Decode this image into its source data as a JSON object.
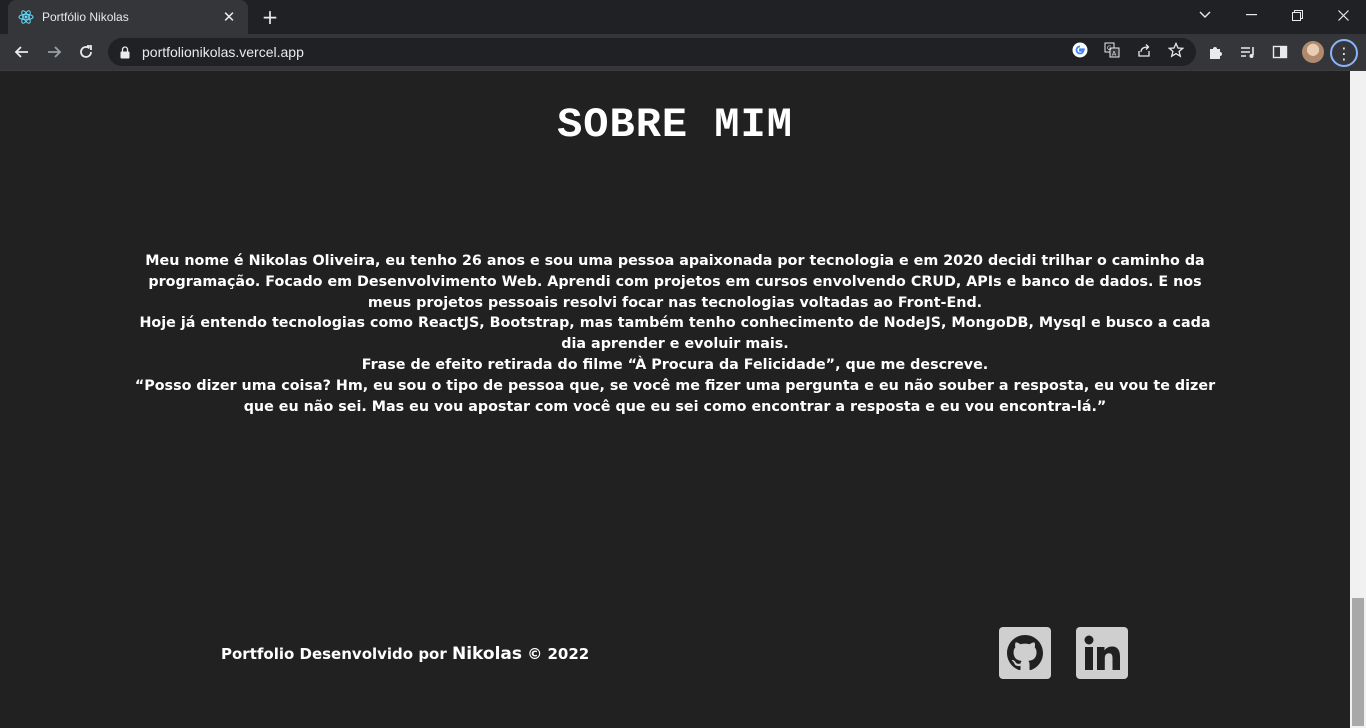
{
  "browser": {
    "tab_title": "Portfólio Nikolas",
    "url": "portfolionikolas.vercel.app",
    "icons": {
      "favicon": "react-icon",
      "close": "close-icon",
      "new_tab": "plus-icon"
    },
    "new_tab_glyph": "+",
    "tab_close_glyph": "✕"
  },
  "about": {
    "title": "SOBRE MIM",
    "paragraphs": [
      "Meu nome é Nikolas Oliveira, eu tenho 26 anos e sou uma pessoa apaixonada por tecnologia e em 2020 decidi trilhar o caminho da programação. Focado em Desenvolvimento Web. Aprendi com projetos em cursos envolvendo CRUD, APIs e banco de dados. E nos meus projetos pessoais resolvi focar nas tecnologias voltadas ao Front-End.",
      "Hoje já entendo tecnologias como ReactJS, Bootstrap, mas também tenho conhecimento de NodeJS, MongoDB, Mysql e busco a cada dia aprender e evoluir mais.",
      "Frase de efeito retirada do filme “À Procura da Felicidade”, que me descreve.",
      "“Posso dizer uma coisa? Hm, eu sou o tipo de pessoa que, se você me fizer uma pergunta e eu não souber a resposta, eu vou te dizer que eu não sei. Mas eu vou apostar com você que eu sei como encontrar a resposta e eu vou encontra-lá.”"
    ]
  },
  "footer": {
    "prefix": "Portfolio Desenvolvido por ",
    "name": "Nikolas",
    "suffix": " © 2022",
    "social": [
      {
        "name": "GitHub",
        "icon": "github-icon"
      },
      {
        "name": "LinkedIn",
        "icon": "linkedin-icon"
      }
    ]
  },
  "colors": {
    "page_background": "#212121",
    "text": "#ffffff",
    "social_tile": "#cfcfcf",
    "social_glyph": "#212121"
  }
}
